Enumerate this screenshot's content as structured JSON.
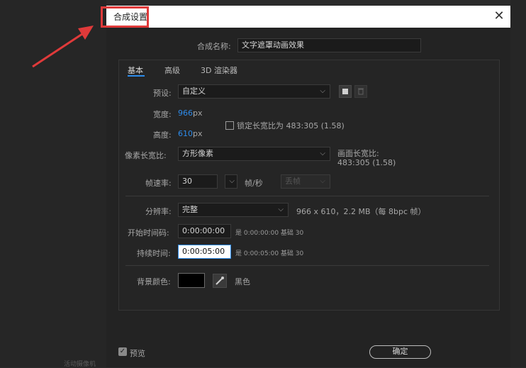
{
  "dialog": {
    "title": "合成设置",
    "close_glyph": "✕"
  },
  "comp_name": {
    "label": "合成名称:",
    "value": "文字遮罩动画效果"
  },
  "tabs": [
    {
      "label": "基本",
      "active": true
    },
    {
      "label": "高级",
      "active": false
    },
    {
      "label": "3D 渲染器",
      "active": false
    }
  ],
  "preset": {
    "label": "预设:",
    "value": "自定义"
  },
  "width": {
    "label": "宽度:",
    "value": "966",
    "unit": "px"
  },
  "height": {
    "label": "高度:",
    "value": "610",
    "unit": "px"
  },
  "lock_aspect": {
    "label": "锁定长宽比为 483:305 (1.58)",
    "checked": false
  },
  "pixel_aspect": {
    "label": "像素长宽比:",
    "value": "方形像素"
  },
  "frame_aspect": {
    "label": "画面长宽比:",
    "value": "483:305 (1.58)"
  },
  "frame_rate": {
    "label": "帧速率:",
    "value": "30",
    "unit": "帧/秒",
    "drop_frame": "丢帧"
  },
  "resolution": {
    "label": "分辨率:",
    "value": "完整",
    "info": "966 x 610，2.2 MB（每 8bpc 帧）"
  },
  "start_timecode": {
    "label": "开始时间码:",
    "value": "0:00:00:00",
    "info": "是 0:00:00:00 基础 30"
  },
  "duration": {
    "label": "持续时间:",
    "value": "0:00:05:00",
    "info": "是 0:00:05:00 基础 30"
  },
  "bg_color": {
    "label": "背景颜色:",
    "name": "黑色",
    "color": "#000000"
  },
  "preview": {
    "label": "预览",
    "checked": true
  },
  "ok": {
    "label": "确定"
  },
  "background_text": {
    "camera": "活动摄像机"
  },
  "colors": {
    "accent_blue": "#2d8ceb",
    "highlight_red": "#e03a3a"
  }
}
